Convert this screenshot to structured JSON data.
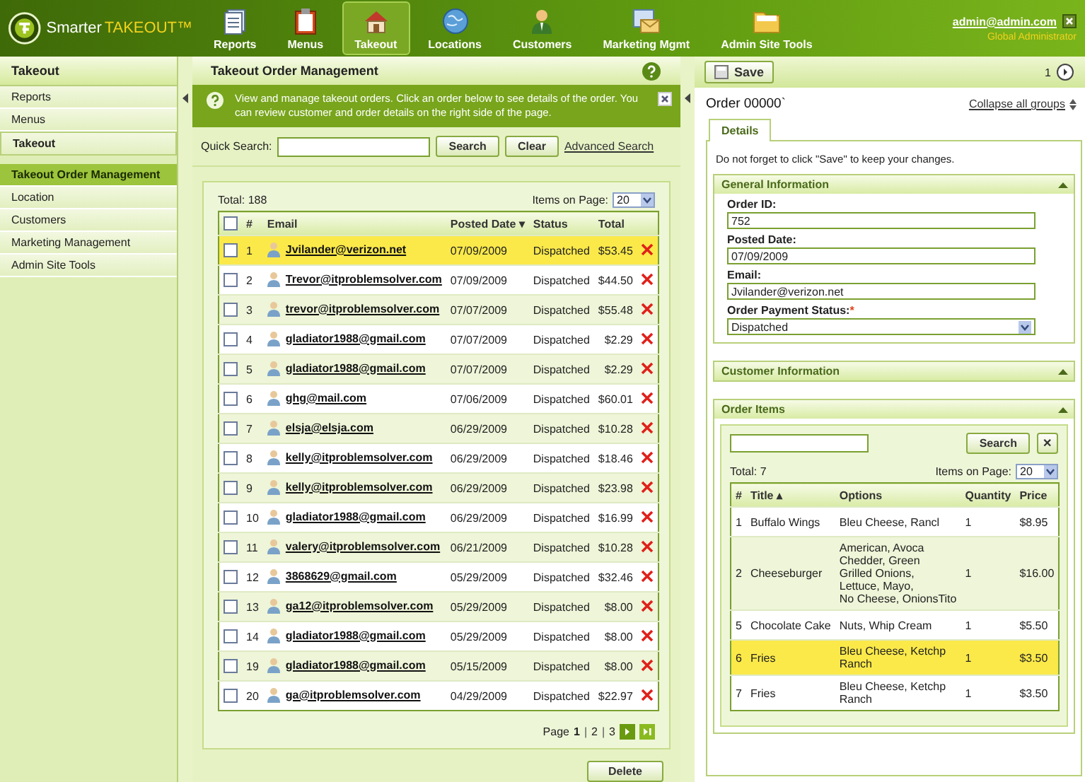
{
  "header": {
    "brand_first": "Smarter",
    "brand_second": "TAKEOUT™",
    "nav": [
      {
        "label": "Reports",
        "selected": false
      },
      {
        "label": "Menus",
        "selected": false
      },
      {
        "label": "Takeout",
        "selected": true
      },
      {
        "label": "Locations",
        "selected": false
      },
      {
        "label": "Customers",
        "selected": false
      },
      {
        "label": "Marketing Mgmt",
        "selected": false
      },
      {
        "label": "Admin Site Tools",
        "selected": false
      }
    ],
    "user_email": "admin@admin.com",
    "user_role": "Global Administrator"
  },
  "sidebar": {
    "title": "Takeout",
    "items": [
      {
        "label": "Reports",
        "kind": "item",
        "selected": false
      },
      {
        "label": "Menus",
        "kind": "item",
        "selected": false
      },
      {
        "label": "Takeout",
        "kind": "group",
        "selected": false
      },
      {
        "label": "Takeout Order Management",
        "kind": "item",
        "selected": true
      },
      {
        "label": "Location",
        "kind": "item",
        "selected": false
      },
      {
        "label": "Customers",
        "kind": "item",
        "selected": false
      },
      {
        "label": "Marketing Management",
        "kind": "item",
        "selected": false
      },
      {
        "label": "Admin Site Tools",
        "kind": "item",
        "selected": false
      }
    ]
  },
  "orders": {
    "title": "Takeout Order Management",
    "info": "View and manage takeout orders. Click an order below to see details of the order. You can review customer and order details on the right side of the page.",
    "quick_search_label": "Quick Search:",
    "search_button": "Search",
    "clear_button": "Clear",
    "advanced_search": "Advanced Search",
    "total": "Total: 188",
    "items_on_page_label": "Items on Page:",
    "items_on_page": "20",
    "select_all_checked": false,
    "columns": [
      "#",
      "Email",
      "Posted Date ▾",
      "Status",
      "Total"
    ],
    "rows": [
      {
        "num": "1",
        "email": "Jvilander@verizon.net",
        "date": "07/09/2009",
        "status": "Dispatched",
        "total": "$53.45",
        "selected": true,
        "checked": false
      },
      {
        "num": "2",
        "email": "Trevor@itproblemsolver.com",
        "date": "07/09/2009",
        "status": "Dispatched",
        "total": "$44.50",
        "selected": false,
        "checked": false
      },
      {
        "num": "3",
        "email": "trevor@itproblemsolver.com",
        "date": "07/07/2009",
        "status": "Dispatched",
        "total": "$55.48",
        "selected": false,
        "checked": false
      },
      {
        "num": "4",
        "email": "gladiator1988@gmail.com",
        "date": "07/07/2009",
        "status": "Dispatched",
        "total": "$2.29",
        "selected": false,
        "checked": false
      },
      {
        "num": "5",
        "email": "gladiator1988@gmail.com",
        "date": "07/07/2009",
        "status": "Dispatched",
        "total": "$2.29",
        "selected": false,
        "checked": false
      },
      {
        "num": "6",
        "email": "ghg@mail.com",
        "date": "07/06/2009",
        "status": "Dispatched",
        "total": "$60.01",
        "selected": false,
        "checked": false
      },
      {
        "num": "7",
        "email": "elsja@elsja.com",
        "date": "06/29/2009",
        "status": "Dispatched",
        "total": "$10.28",
        "selected": false,
        "checked": false
      },
      {
        "num": "8",
        "email": "kelly@itproblemsolver.com",
        "date": "06/29/2009",
        "status": "Dispatched",
        "total": "$18.46",
        "selected": false,
        "checked": false
      },
      {
        "num": "9",
        "email": "kelly@itproblemsolver.com",
        "date": "06/29/2009",
        "status": "Dispatched",
        "total": "$23.98",
        "selected": false,
        "checked": false
      },
      {
        "num": "10",
        "email": "gladiator1988@gmail.com",
        "date": "06/29/2009",
        "status": "Dispatched",
        "total": "$16.99",
        "selected": false,
        "checked": false
      },
      {
        "num": "11",
        "email": "valery@itproblemsolver.com",
        "date": "06/21/2009",
        "status": "Dispatched",
        "total": "$10.28",
        "selected": false,
        "checked": false
      },
      {
        "num": "12",
        "email": "3868629@gmail.com",
        "date": "05/29/2009",
        "status": "Dispatched",
        "total": "$32.46",
        "selected": false,
        "checked": false
      },
      {
        "num": "13",
        "email": "ga12@itproblemsolver.com",
        "date": "05/29/2009",
        "status": "Dispatched",
        "total": "$8.00",
        "selected": false,
        "checked": false
      },
      {
        "num": "14",
        "email": "gladiator1988@gmail.com",
        "date": "05/29/2009",
        "status": "Dispatched",
        "total": "$8.00",
        "selected": false,
        "checked": false
      },
      {
        "num": "19",
        "email": "gladiator1988@gmail.com",
        "date": "05/15/2009",
        "status": "Dispatched",
        "total": "$8.00",
        "selected": false,
        "checked": false
      },
      {
        "num": "20",
        "email": "ga@itproblemsolver.com",
        "date": "04/29/2009",
        "status": "Dispatched",
        "total": "$22.97",
        "selected": false,
        "checked": false
      }
    ],
    "page_label": "Page",
    "page_separator": "|",
    "pages": [
      {
        "label": "1",
        "selected": true
      },
      {
        "label": "2",
        "selected": false
      },
      {
        "label": "3",
        "selected": false
      }
    ],
    "delete_button": "Delete"
  },
  "details": {
    "save_button": "Save",
    "page": "1",
    "order_title": "Order 00000`",
    "collapse_link": "Collapse all groups",
    "tabs": [
      {
        "label": "Details",
        "selected": true
      }
    ],
    "note": "Do not forget to click \"Save\" to keep your changes.",
    "general": {
      "title": "General Information",
      "required_mark": "*",
      "fields": [
        {
          "label": "Order ID:",
          "value": "752",
          "kind": "text",
          "required": false
        },
        {
          "label": "Posted Date:",
          "value": "07/09/2009",
          "kind": "text",
          "required": false
        },
        {
          "label": "Email:",
          "value": "Jvilander@verizon.net",
          "kind": "text",
          "required": false
        },
        {
          "label": "Order Payment Status:",
          "value": "Dispatched",
          "kind": "select",
          "required": true
        }
      ]
    },
    "customer_title": "Customer Information",
    "items": {
      "title": "Order Items",
      "search_button": "Search",
      "clear_button": "✕",
      "total": "Total: 7",
      "items_on_page_label": "Items on Page:",
      "items_on_page": "20",
      "columns": [
        "#",
        "Title ▴",
        "Options",
        "Quantity",
        "Price"
      ],
      "rows": [
        {
          "num": "1",
          "title": "Buffalo Wings",
          "options": "Bleu Cheese, Rancl",
          "quantity": "1",
          "price": "$8.95",
          "selected": false
        },
        {
          "num": "2",
          "title": "Cheeseburger",
          "options": "American, Avoca\nChedder, Green\nGrilled Onions,\nLettuce, Mayo,\nNo Cheese, OnionsTito",
          "quantity": "1",
          "price": "$16.00",
          "selected": false
        },
        {
          "num": "5",
          "title": "Chocolate Cake",
          "options": "Nuts, Whip Cream",
          "quantity": "1",
          "price": "$5.50",
          "selected": false
        },
        {
          "num": "6",
          "title": "Fries",
          "options": "Bleu Cheese, Ketchp\nRanch",
          "quantity": "1",
          "price": "$3.50",
          "selected": true
        },
        {
          "num": "7",
          "title": "Fries",
          "options": "Bleu Cheese, Ketchp\nRanch",
          "quantity": "1",
          "price": "$3.50",
          "selected": false
        }
      ]
    }
  }
}
